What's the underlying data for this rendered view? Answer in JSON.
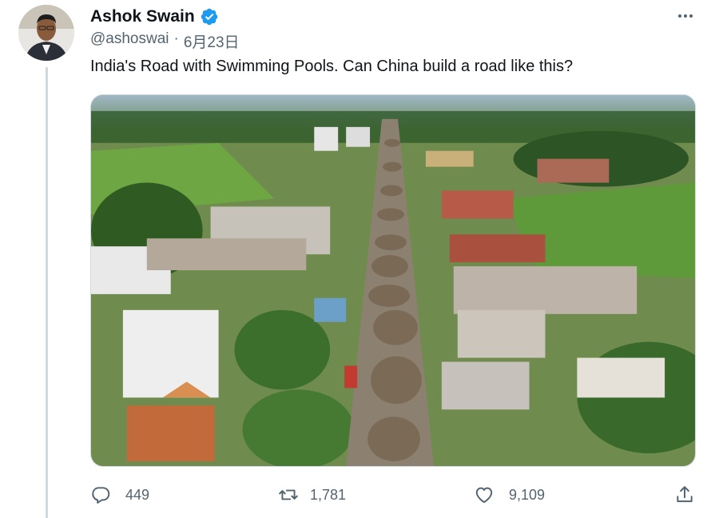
{
  "tweet": {
    "author_name": "Ashok Swain",
    "handle": "@ashoswai",
    "separator": "·",
    "date": "6月23日",
    "text": "India's Road with Swimming Pools. Can China build a road like this?",
    "verified": true
  },
  "metrics": {
    "replies": "449",
    "retweets": "1,781",
    "likes": "9,109"
  },
  "icons": {
    "more": "more-horizontal-icon",
    "reply": "reply-icon",
    "retweet": "retweet-icon",
    "like": "heart-icon",
    "share": "share-icon",
    "verified": "verified-badge-icon"
  },
  "colors": {
    "text_primary": "#0f1419",
    "text_secondary": "#536471",
    "verified_blue": "#1d9bf0",
    "thread_line": "#cfd9de"
  }
}
